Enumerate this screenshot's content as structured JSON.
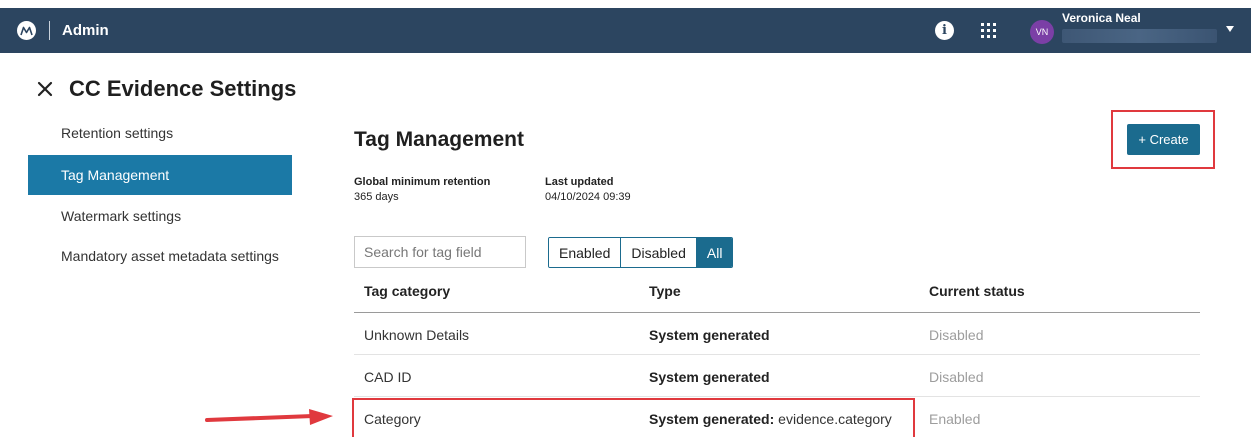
{
  "header": {
    "app_name": "Admin",
    "user_name": "Veronica Neal",
    "user_initials": "VN",
    "icons": [
      "motorola-logo-icon",
      "info-icon",
      "apps-grid-icon",
      "chevron-down-icon"
    ]
  },
  "page": {
    "title": "CC Evidence Settings"
  },
  "sidebar": {
    "items": [
      {
        "label": "Retention settings"
      },
      {
        "label": "Tag Management"
      },
      {
        "label": "Watermark settings"
      },
      {
        "label": "Mandatory asset metadata settings"
      }
    ],
    "active_index": 1
  },
  "main": {
    "title": "Tag Management",
    "create_label": "+ Create",
    "global_min_retention_label": "Global minimum retention",
    "global_min_retention_value": "365 days",
    "last_updated_label": "Last updated",
    "last_updated_value": "04/10/2024 09:39",
    "search_placeholder": "Search for tag field",
    "filters": [
      "Enabled",
      "Disabled",
      "All"
    ],
    "active_filter": "All",
    "table": {
      "headers": [
        "Tag category",
        "Type",
        "Current status"
      ],
      "rows": [
        {
          "category": "Unknown Details",
          "type": "System generated",
          "type_detail": "",
          "status": "Disabled"
        },
        {
          "category": "CAD ID",
          "type": "System generated",
          "type_detail": "",
          "status": "Disabled"
        },
        {
          "category": "Category",
          "type": "System generated:",
          "type_detail": "evidence.category",
          "status": "Enabled"
        }
      ]
    }
  },
  "colors": {
    "topbar": "#2c4560",
    "accent": "#1b79a6",
    "button": "#1b6b8e",
    "avatar": "#7b3fa6",
    "highlight": "#e0393e"
  }
}
